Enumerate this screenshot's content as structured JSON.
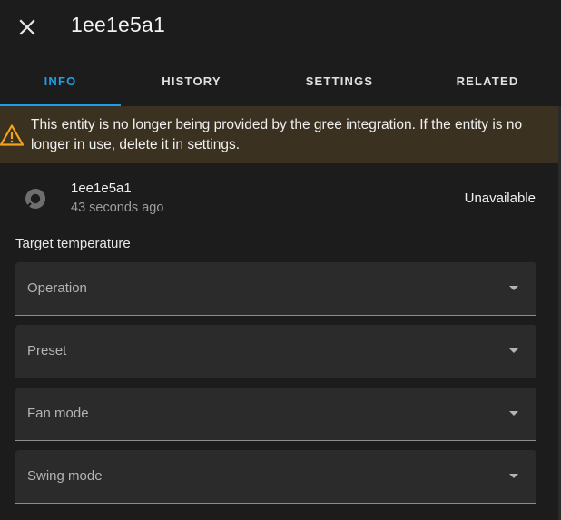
{
  "header": {
    "close_icon": "close-icon",
    "title": "1ee1e5a1"
  },
  "tabs": [
    {
      "label": "INFO",
      "active": true
    },
    {
      "label": "HISTORY",
      "active": false
    },
    {
      "label": "SETTINGS",
      "active": false
    },
    {
      "label": "RELATED",
      "active": false
    }
  ],
  "warning": {
    "icon": "alert-triangle-icon",
    "color": "#f2a21b",
    "text": "This entity is no longer being provided by the gree integration. If the entity is no longer in use, delete it in settings."
  },
  "entity": {
    "icon": "thermostat-icon",
    "name": "1ee1e5a1",
    "last_changed": "43 seconds ago",
    "state": "Unavailable"
  },
  "controls": {
    "target_temperature_label": "Target temperature",
    "selects": [
      {
        "label": "Operation"
      },
      {
        "label": "Preset"
      },
      {
        "label": "Fan mode"
      },
      {
        "label": "Swing mode"
      }
    ]
  },
  "colors": {
    "accent": "#1e9ee6",
    "background": "#1c1c1c",
    "warning_bg": "#3a3120"
  }
}
